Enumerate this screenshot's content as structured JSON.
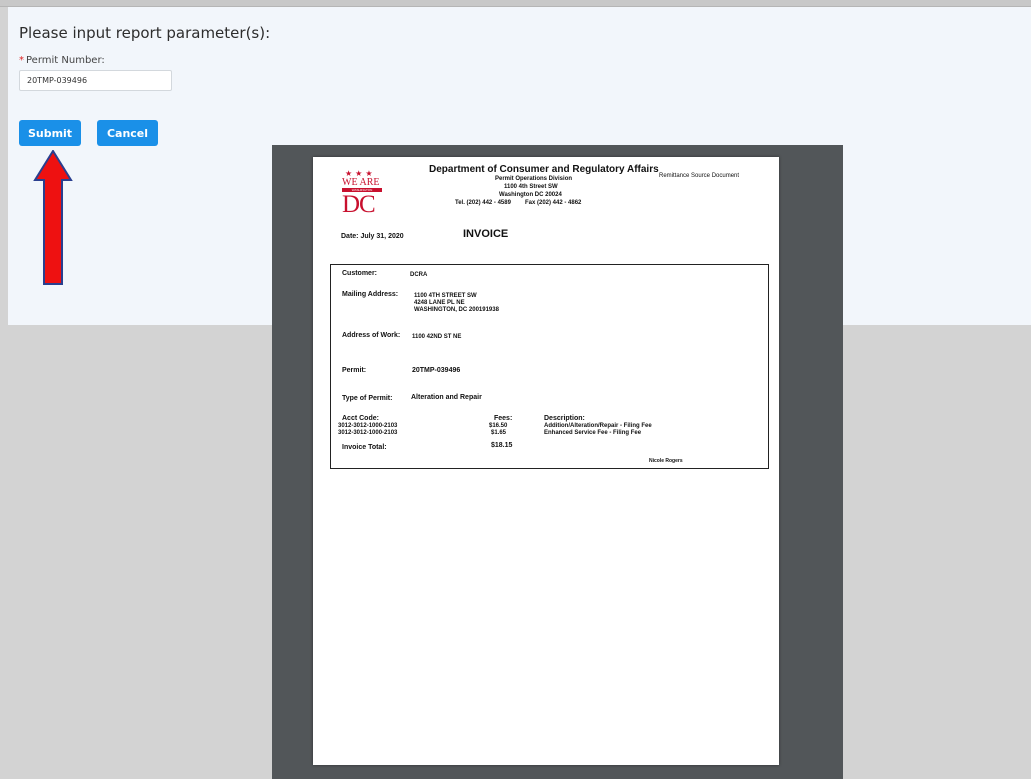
{
  "form": {
    "heading": "Please input report parameter(s):",
    "required_mark": "*",
    "permit_label": "Permit Number:",
    "permit_value": "20TMP-039496",
    "submit_label": "Submit",
    "cancel_label": "Cancel"
  },
  "invoice": {
    "org_name": "Department of Consumer and Regulatory Affairs",
    "division": "Permit Operations Division",
    "street": "1100 4th Street SW",
    "city": "Washington DC 20024",
    "tel": "Tel. (202) 442 - 4589",
    "fax": "Fax (202) 442 - 4862",
    "doc_type": "Remittance Source Document",
    "logo_we_are": "WE ARE",
    "logo_washington": "WASHINGTON",
    "logo_dc": "DC",
    "date": "Date: July 31, 2020",
    "title": "INVOICE",
    "customer_label": "Customer:",
    "customer_value": "DCRA",
    "mailing_label": "Mailing Address:",
    "mailing_line1": "1100 4TH STREET SW",
    "mailing_line2": "4248 LANE PL NE",
    "mailing_line3": "WASHINGTON, DC 200191938",
    "work_label": "Address of Work:",
    "work_value": "1100 42ND ST NE",
    "permit_label": "Permit:",
    "permit_value": "20TMP-039496",
    "type_label": "Type of Permit:",
    "type_value": "Alteration and Repair",
    "acct_header": "Acct Code:",
    "fees_header": "Fees:",
    "desc_header": "Description:",
    "line_items": [
      {
        "acct": "3012-3012-1000-2103",
        "fee": "$16.50",
        "desc": "Addition/Alteration/Repair - Filing Fee"
      },
      {
        "acct": "3012-3012-1000-2103",
        "fee": "$1.65",
        "desc": "Enhanced Service Fee - Filing Fee"
      }
    ],
    "total_label": "Invoice Total:",
    "total_value": "$18.15",
    "signer": "Nicole Rogers"
  },
  "colors": {
    "accent": "#1a90e8",
    "arrow_fill": "#ee1111",
    "arrow_outline": "#2a3f8f",
    "logo_red": "#c8102e"
  },
  "icons": {
    "annotation": "red-up-arrow"
  }
}
